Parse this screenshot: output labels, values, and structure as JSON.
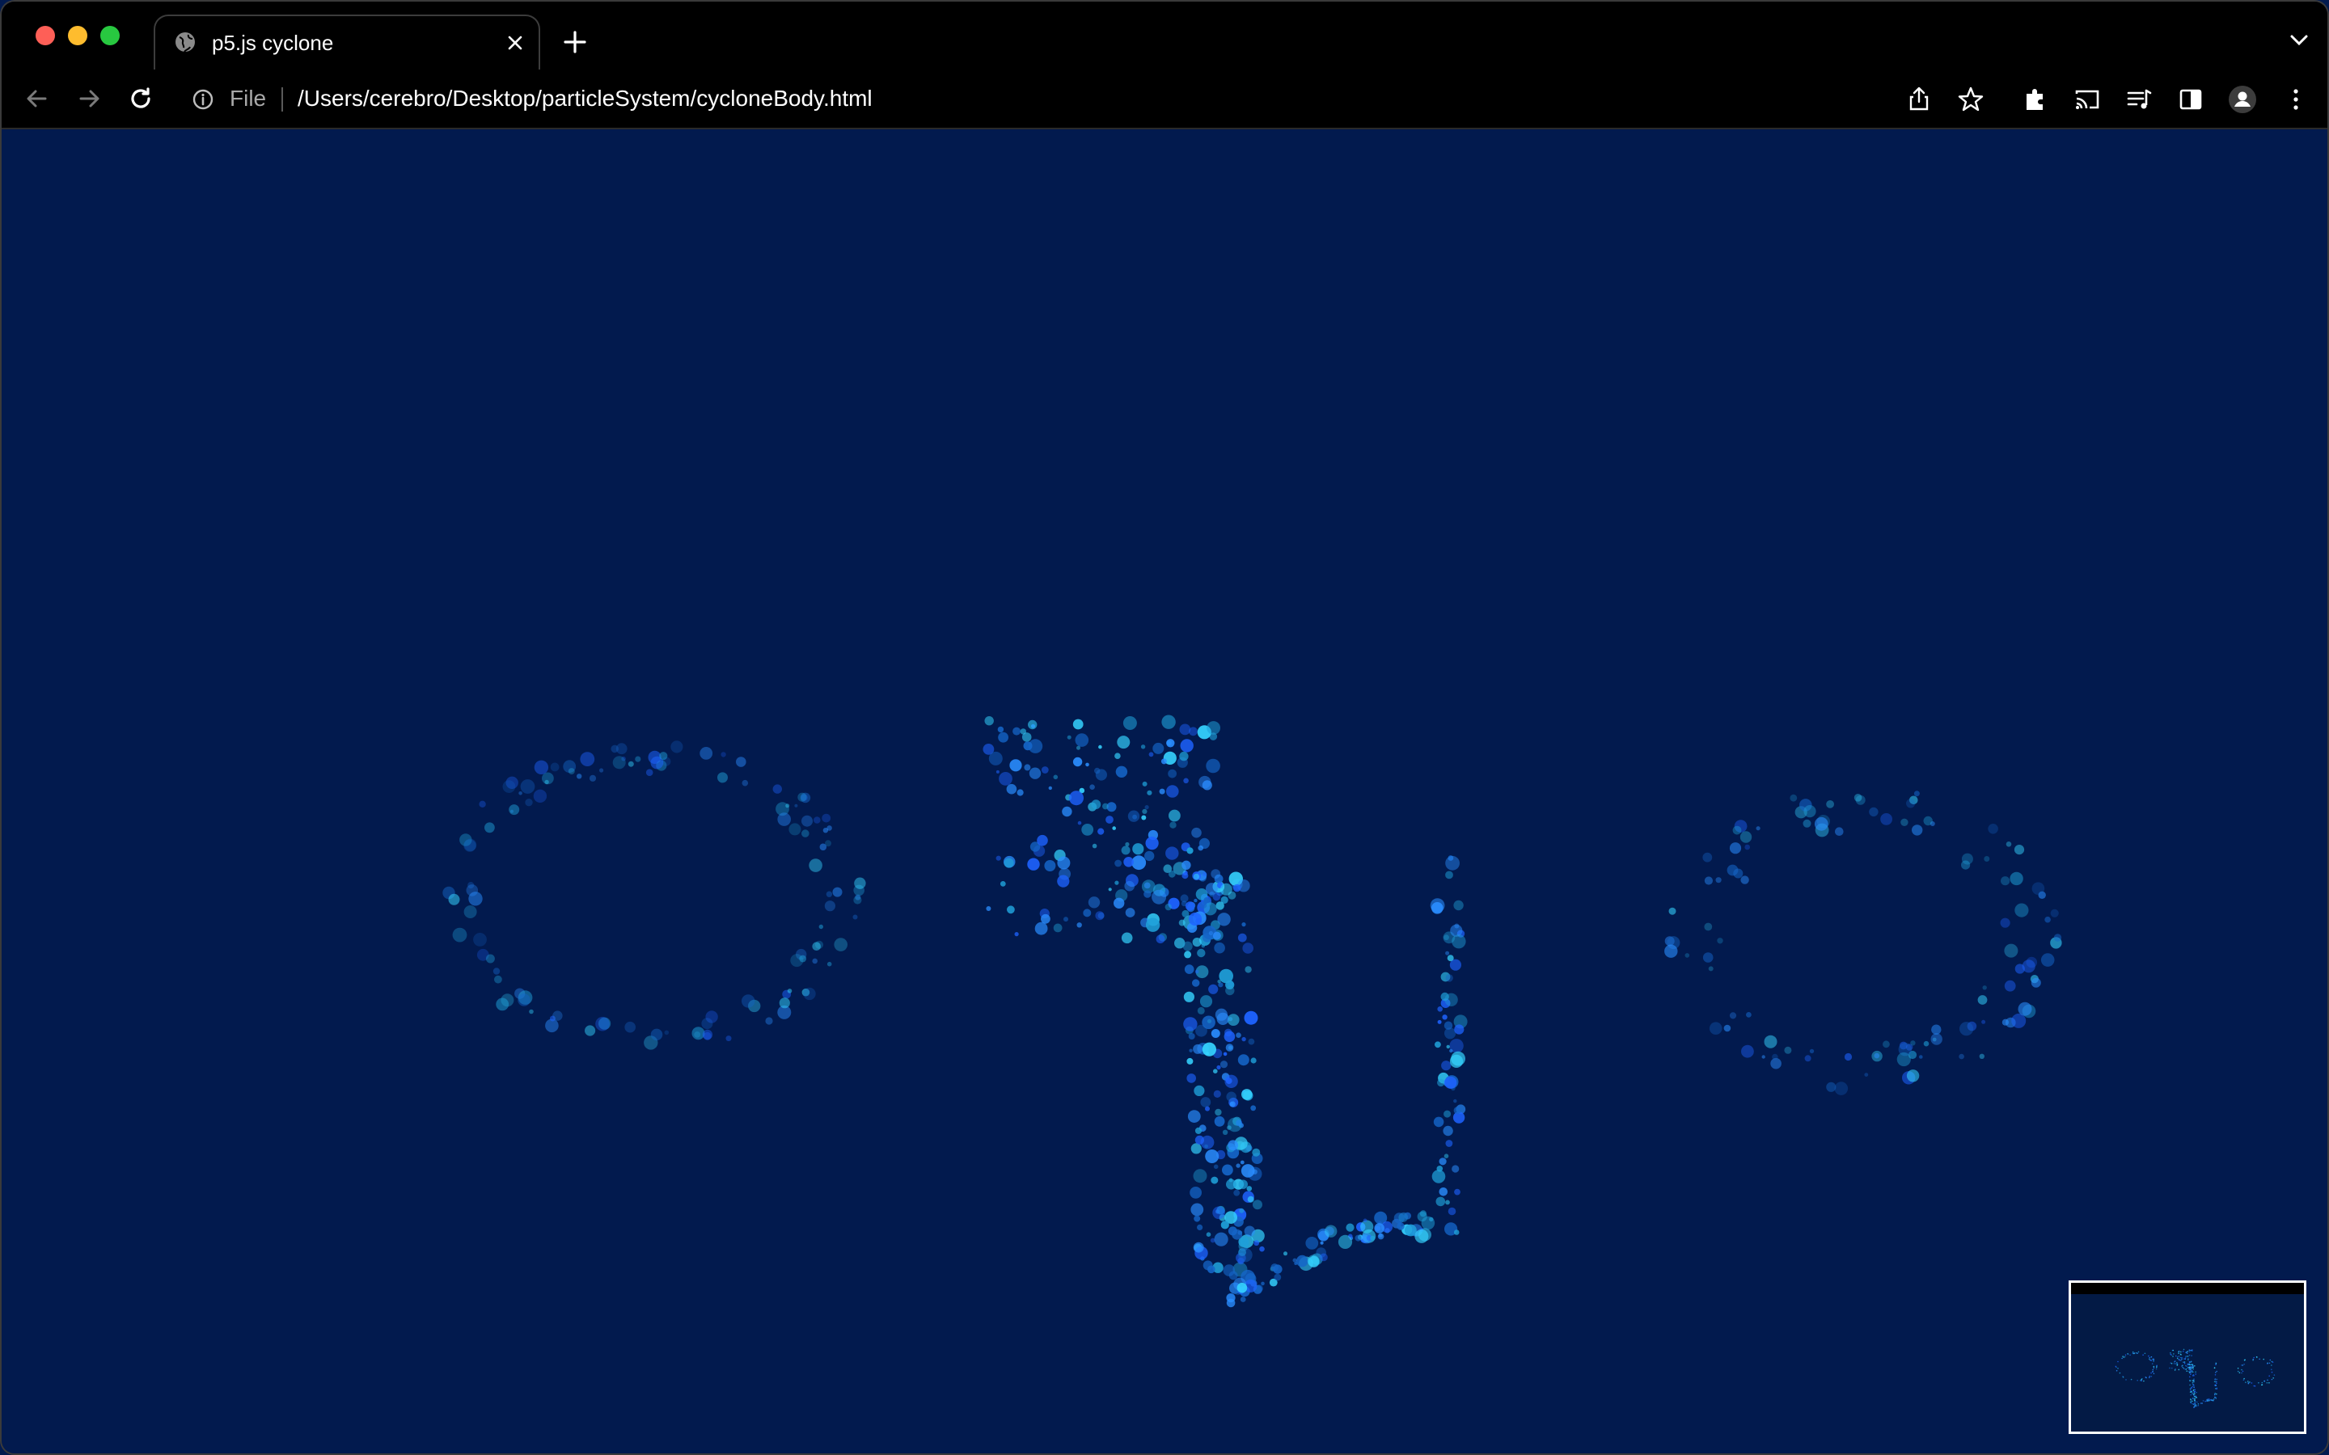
{
  "tab": {
    "title": "p5.js cyclone"
  },
  "toolbar": {
    "file_label": "File",
    "url": "/Users/cerebro/Desktop/particleSystem/cycloneBody.html"
  },
  "colors": {
    "page_background": "#021a4e",
    "particle_colors": [
      "#1e63ff",
      "#2a8dff",
      "#35d3ff",
      "#1f9fd8",
      "#1565c8"
    ]
  },
  "icons": {
    "toolbar_right": [
      "share-icon",
      "star-icon",
      "extensions-icon",
      "cast-icon",
      "media-icon",
      "side-panel-icon",
      "profile-icon",
      "menu-icon"
    ]
  }
}
